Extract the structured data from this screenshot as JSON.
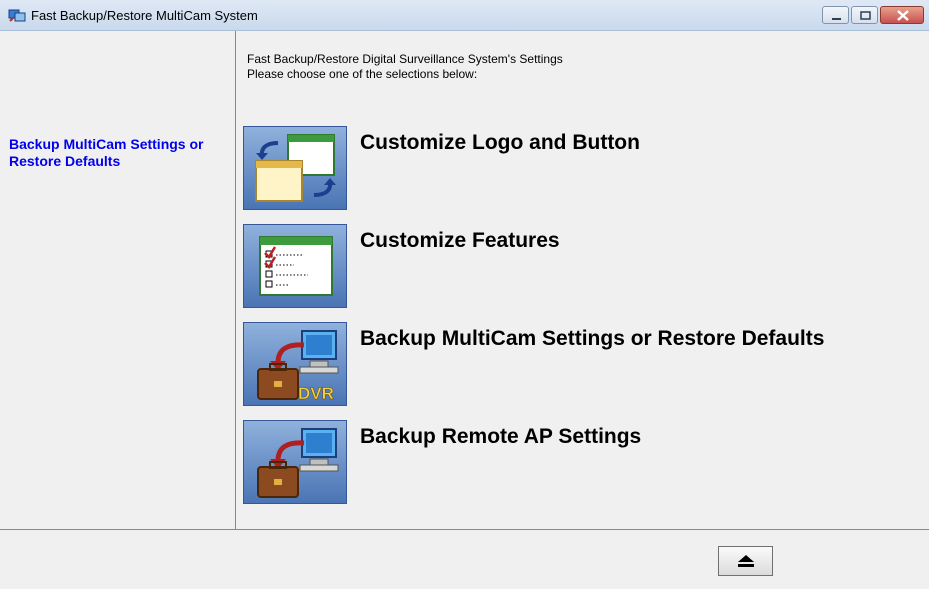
{
  "window": {
    "title": "Fast Backup/Restore MultiCam System"
  },
  "sidebar": {
    "selected_item": "Backup MultiCam Settings or Restore Defaults"
  },
  "main": {
    "header_line1": "Fast Backup/Restore Digital Surveillance System's Settings",
    "header_line2": "Please choose one of the selections below:",
    "options": [
      {
        "label": "Customize Logo and Button",
        "icon": "windows-swap-icon"
      },
      {
        "label": "Customize Features",
        "icon": "checklist-icon"
      },
      {
        "label": "Backup MultiCam Settings or Restore Defaults",
        "icon": "briefcase-dvr-icon",
        "icon_text": "DVR"
      },
      {
        "label": "Backup Remote AP Settings",
        "icon": "briefcase-computer-icon"
      }
    ]
  },
  "footer": {
    "eject_icon": "eject-icon"
  }
}
